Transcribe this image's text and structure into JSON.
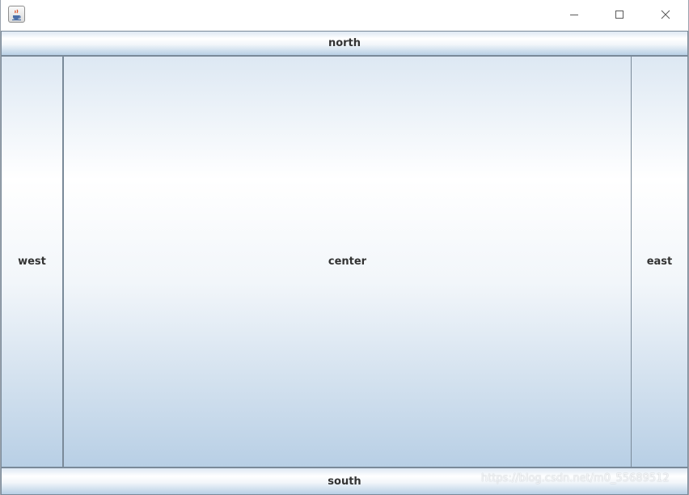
{
  "window": {
    "icon": "java-coffee-cup-icon",
    "controls": {
      "minimize_icon": "minimize-icon",
      "maximize_icon": "maximize-icon",
      "close_icon": "close-icon"
    }
  },
  "layout": {
    "north_label": "north",
    "south_label": "south",
    "west_label": "west",
    "center_label": "center",
    "east_label": "east"
  },
  "watermark": "https://blog.csdn.net/m0_55689512",
  "colors": {
    "button_border": "#7a8a99",
    "button_gradient_top": "#dde8f3",
    "button_gradient_mid": "#ffffff",
    "button_gradient_bottom": "#b8cfe5",
    "button_text": "#333333"
  }
}
